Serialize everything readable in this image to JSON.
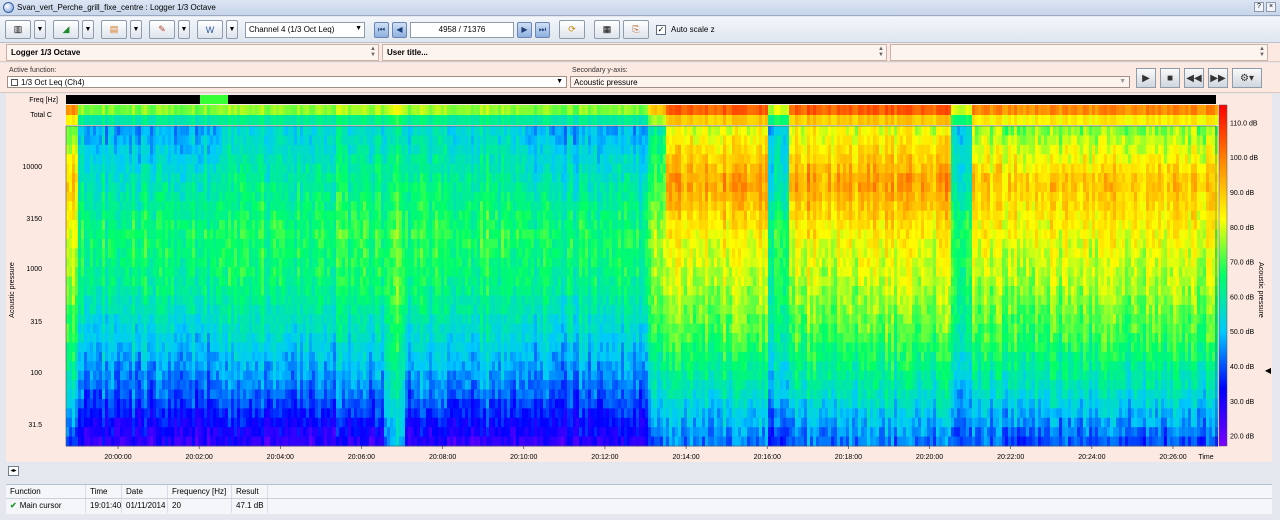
{
  "window": {
    "title": "Svan_vert_Perche_grill_fixe_centre : Logger 1/3 Octave",
    "controls": [
      "?",
      "×"
    ]
  },
  "toolbar": {
    "channel_select": "Channel 4 (1/3 Oct Leq)",
    "record_counter": "4958 / 71376",
    "auto_scale_label": "Auto scale z",
    "auto_scale_checked": true
  },
  "header": {
    "logger_label": "Logger 1/3 Octave",
    "user_title_label": "User title..."
  },
  "function_bar": {
    "active_function_label": "Active function:",
    "active_function_value": "1/3 Oct Leq (Ch4)",
    "secondary_axis_label": "Secondary y-axis:",
    "secondary_axis_value": "Acoustic pressure"
  },
  "chart_data": {
    "type": "heatmap",
    "row_labels": {
      "freq_header": "Freq [Hz]",
      "total": "Total C"
    },
    "ylabel": "Acoustic pressure",
    "yticks": [
      "10000",
      "3150",
      "1000",
      "315",
      "100",
      "31.5"
    ],
    "xlabel": "Time",
    "xticks": [
      "20:00:00",
      "20:02:00",
      "20:04:00",
      "20:06:00",
      "20:08:00",
      "20:10:00",
      "20:12:00",
      "20:14:00",
      "20:16:00",
      "20:18:00",
      "20:20:00",
      "20:22:00",
      "20:24:00",
      "20:26:00"
    ],
    "colorbar": {
      "label": "Acoustic pressure",
      "ticks": [
        "110.0 dB",
        "100.0 dB",
        "90.0 dB",
        "80.0 dB",
        "70.0 dB",
        "60.0 dB",
        "50.0 dB",
        "40.0 dB",
        "30.0 dB",
        "20.0 dB"
      ],
      "range_db": [
        17,
        115
      ],
      "colors": [
        "#7a00ff",
        "#0000ff",
        "#00c8ff",
        "#00ff66",
        "#ffff00",
        "#ff8800",
        "#ff0000"
      ]
    },
    "time_minutes": [
      20,
      27
    ],
    "time_segments": [
      {
        "start": "19:59:00",
        "end": "20:02:30",
        "profile": "quiet"
      },
      {
        "start": "20:02:30",
        "end": "20:06:30",
        "profile": "moderate"
      },
      {
        "start": "20:06:30",
        "end": "20:07:00",
        "profile": "broadband_burst"
      },
      {
        "start": "20:07:00",
        "end": "20:10:00",
        "profile": "moderate"
      },
      {
        "start": "20:10:00",
        "end": "20:13:00",
        "profile": "quiet"
      },
      {
        "start": "20:13:00",
        "end": "20:13:30",
        "profile": "transition"
      },
      {
        "start": "20:13:30",
        "end": "20:16:00",
        "profile": "loud"
      },
      {
        "start": "20:16:00",
        "end": "20:16:30",
        "profile": "gap"
      },
      {
        "start": "20:16:30",
        "end": "20:20:30",
        "profile": "loud"
      },
      {
        "start": "20:20:30",
        "end": "20:21:00",
        "profile": "gap"
      },
      {
        "start": "20:21:00",
        "end": "20:27:00",
        "profile": "loud_variable"
      }
    ]
  },
  "cursor_table": {
    "headers": [
      "Function",
      "Time",
      "Date",
      "Frequency [Hz]",
      "Result"
    ],
    "rows": [
      {
        "function": "Main cursor",
        "time": "19:01:40",
        "date": "01/11/2014",
        "frequency": "20",
        "result": "47.1 dB"
      }
    ]
  }
}
